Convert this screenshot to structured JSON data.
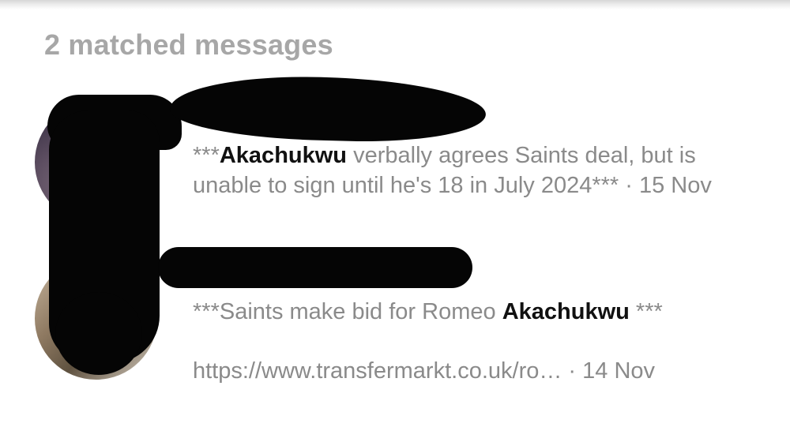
{
  "results_header": "2 matched messages",
  "messages": [
    {
      "sender": "",
      "prefix": "***",
      "highlight": "Akachukwu",
      "text": " verbally agrees Saints deal, but is unable to sign until he's 18 in July 2024*** · 15 Nov"
    },
    {
      "sender": "",
      "prefix": "***Saints make bid for Romeo ",
      "highlight": "Akachukwu",
      "suffix": " ***",
      "link": "https://www.transfermarkt.co.uk/ro…",
      "date": " · 14 Nov"
    }
  ],
  "colors": {
    "header": "#a7a7a7",
    "body_text": "#8a8a8a",
    "highlight": "#111111",
    "redaction": "#050505"
  }
}
